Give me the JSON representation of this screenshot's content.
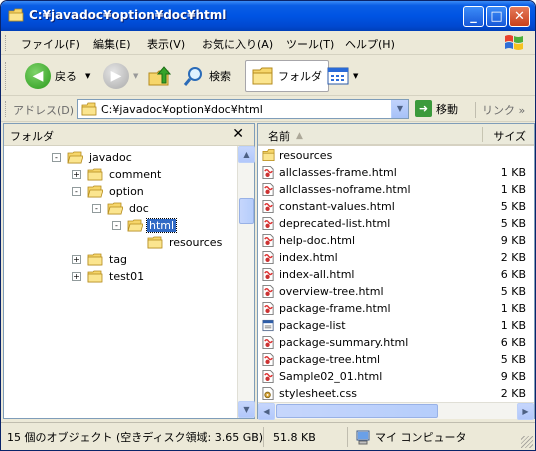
{
  "window": {
    "title": "C:¥javadoc¥option¥doc¥html"
  },
  "menu": [
    "ファイル(F)",
    "編集(E)",
    "表示(V)",
    "お気に入り(A)",
    "ツール(T)",
    "ヘルプ(H)"
  ],
  "toolbar": {
    "back": "戻る",
    "search": "検索",
    "folders": "フォルダ"
  },
  "address": {
    "label": "アドレス(D)",
    "value": "C:¥javadoc¥option¥doc¥html",
    "go": "移動",
    "links": "リンク"
  },
  "folder_pane": {
    "title": "フォルダ",
    "tree": [
      {
        "label": "javadoc",
        "expander": "-"
      },
      {
        "label": "comment",
        "expander": "+"
      },
      {
        "label": "option",
        "expander": "-"
      },
      {
        "label": "doc",
        "expander": "-"
      },
      {
        "label": "html",
        "expander": "-",
        "selected": true
      },
      {
        "label": "resources",
        "expander": ""
      },
      {
        "label": "tag",
        "expander": "+"
      },
      {
        "label": "test01",
        "expander": "+"
      }
    ]
  },
  "files": {
    "columns": {
      "name": "名前",
      "size": "サイズ"
    },
    "rows": [
      {
        "name": "resources",
        "size": "",
        "icon": "folder-icon"
      },
      {
        "name": "allclasses-frame.html",
        "size": "1 KB",
        "icon": "html-file-icon"
      },
      {
        "name": "allclasses-noframe.html",
        "size": "1 KB",
        "icon": "html-file-icon"
      },
      {
        "name": "constant-values.html",
        "size": "5 KB",
        "icon": "html-file-icon"
      },
      {
        "name": "deprecated-list.html",
        "size": "5 KB",
        "icon": "html-file-icon"
      },
      {
        "name": "help-doc.html",
        "size": "9 KB",
        "icon": "html-file-icon"
      },
      {
        "name": "index.html",
        "size": "2 KB",
        "icon": "html-file-icon"
      },
      {
        "name": "index-all.html",
        "size": "6 KB",
        "icon": "html-file-icon"
      },
      {
        "name": "overview-tree.html",
        "size": "5 KB",
        "icon": "html-file-icon"
      },
      {
        "name": "package-frame.html",
        "size": "1 KB",
        "icon": "html-file-icon"
      },
      {
        "name": "package-list",
        "size": "1 KB",
        "icon": "generic-file-icon"
      },
      {
        "name": "package-summary.html",
        "size": "6 KB",
        "icon": "html-file-icon"
      },
      {
        "name": "package-tree.html",
        "size": "5 KB",
        "icon": "html-file-icon"
      },
      {
        "name": "Sample02_01.html",
        "size": "9 KB",
        "icon": "html-file-icon"
      },
      {
        "name": "stylesheet.css",
        "size": "2 KB",
        "icon": "css-file-icon"
      }
    ]
  },
  "status": {
    "objects": "15 個のオブジェクト (空きディスク領域: 3.65 GB)",
    "size": "51.8 KB",
    "location": "マイ コンピュータ"
  }
}
